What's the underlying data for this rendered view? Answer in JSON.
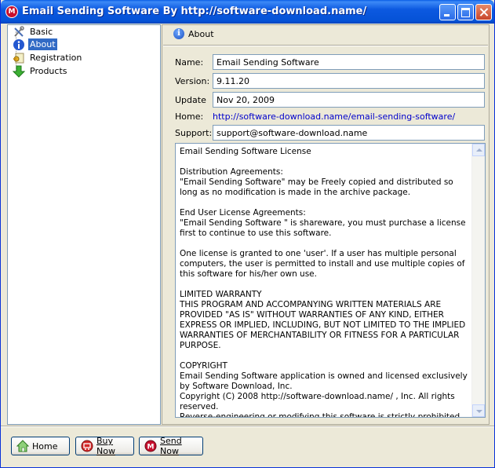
{
  "window": {
    "title": "Email Sending Software  By http://software-download.name/",
    "app_icon_letter": "M"
  },
  "tree": {
    "items": [
      {
        "label": "Basic",
        "icon": "wrench-screwdriver-icon"
      },
      {
        "label": "About",
        "icon": "info-icon",
        "selected": true
      },
      {
        "label": "Registration",
        "icon": "key-certificate-icon"
      },
      {
        "label": "Products",
        "icon": "green-down-arrow-icon"
      }
    ]
  },
  "about": {
    "header": "About",
    "name_label": "Name:",
    "name_value": "Email Sending Software",
    "version_label": "Version:",
    "version_value": "9.11.20",
    "update_label": "Update",
    "update_value": "Nov 20, 2009",
    "home_label": "Home:",
    "home_link": "http://software-download.name/email-sending-software/",
    "support_label": "Support:",
    "support_value": "support@software-download.name",
    "license_text": "Email Sending Software License\n\nDistribution Agreements:\n\"Email Sending Software\" may be Freely copied and distributed so long as no modification is made in the archive package.\n\nEnd User License Agreements:\n\"Email Sending Software \" is shareware, you must purchase a license first to continue to use this software.\n\nOne license is granted to one 'user'. If a user has multiple personal computers, the user is permitted to install and use multiple copies of this software for his/her own use.\n\nLIMITED WARRANTY\nTHIS PROGRAM AND ACCOMPANYING WRITTEN MATERIALS ARE PROVIDED \"AS IS\" WITHOUT WARRANTIES OF ANY KIND, EITHER EXPRESS OR IMPLIED, INCLUDING, BUT NOT LIMITED TO THE IMPLIED WARRANTIES OF MERCHANTABILITY OR FITNESS FOR A PARTICULAR PURPOSE.\n\nCOPYRIGHT\nEmail Sending Software application is owned and licensed exclusively by Software Download, Inc.\nCopyright (C) 2008 http://software-download.name/ , Inc. All rights reserved.\nReverse-engineering or modifying this software is strictly prohibited."
  },
  "buttons": {
    "home": "Home",
    "buy_now": "Buy Now",
    "send_now": "Send Now"
  }
}
